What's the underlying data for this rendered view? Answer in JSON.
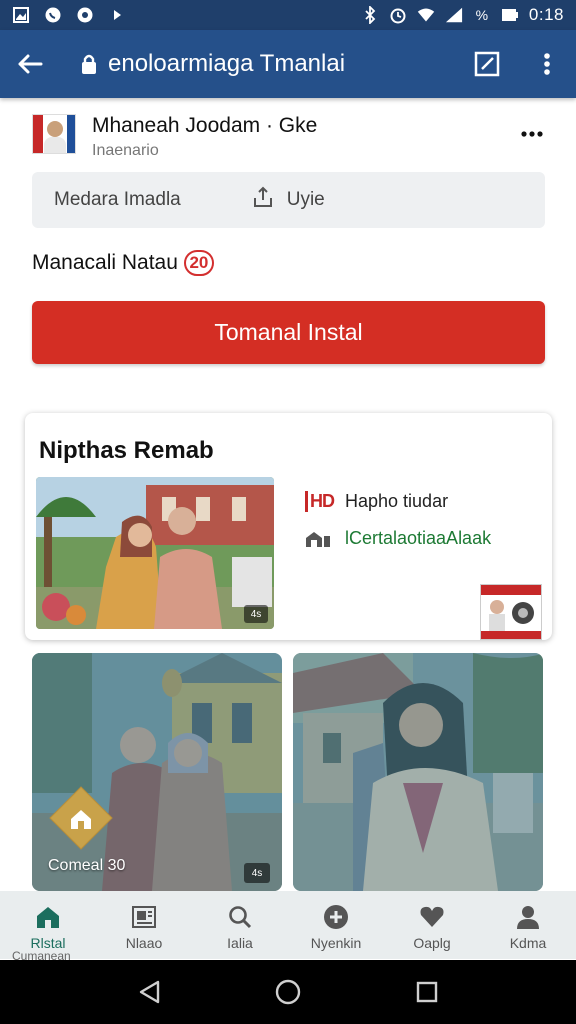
{
  "status_bar": {
    "time": "0:18",
    "icons": [
      "gallery-icon",
      "whatsapp-icon",
      "circle-icon",
      "play-icon",
      "bluetooth-icon",
      "alarm-icon",
      "wifi-icon",
      "signal-icon",
      "percent-icon",
      "battery-icon"
    ]
  },
  "app_bar": {
    "url": "enoloarmiaga Tmanlai",
    "icons": [
      "back-arrow-icon",
      "lock-icon",
      "edit-square-icon",
      "more-vert-icon"
    ]
  },
  "profile": {
    "name": "Mhaneah Joodam ·  Gke",
    "subtitle": "Inaenario"
  },
  "field": {
    "left_text": "Medara Imadla",
    "right_text": "Uyie"
  },
  "label_row": {
    "text": "Manacali Natau",
    "badge": "20"
  },
  "primary_button": {
    "label": "Tomanal Instal"
  },
  "card": {
    "title": "Nipthas Remab",
    "meta_1": "Hapho tiudar",
    "meta_1_tag": "HD",
    "meta_2": "lCertalaotiaaAlaak",
    "photo_duration": "4s"
  },
  "tiles": [
    {
      "label": "Comeal 30",
      "duration": "4s"
    },
    {
      "label": "",
      "duration": ""
    }
  ],
  "bottom_nav": {
    "items": [
      {
        "label": "Rlstal",
        "icon": "home-icon",
        "active": true,
        "sub": "Cumanean"
      },
      {
        "label": "Nlaao",
        "icon": "news-icon",
        "active": false
      },
      {
        "label": "Ialia",
        "icon": "search-icon",
        "active": false
      },
      {
        "label": "Nyenkin",
        "icon": "add-circle-icon",
        "active": false
      },
      {
        "label": "Oaplg",
        "icon": "heart-icon",
        "active": false
      },
      {
        "label": "Kdma",
        "icon": "person-icon",
        "active": false
      }
    ]
  },
  "colors": {
    "status_bar": "#1f3f6b",
    "app_bar": "#25508a",
    "primary": "#d42e24",
    "nav_active": "#1c6e5e"
  }
}
